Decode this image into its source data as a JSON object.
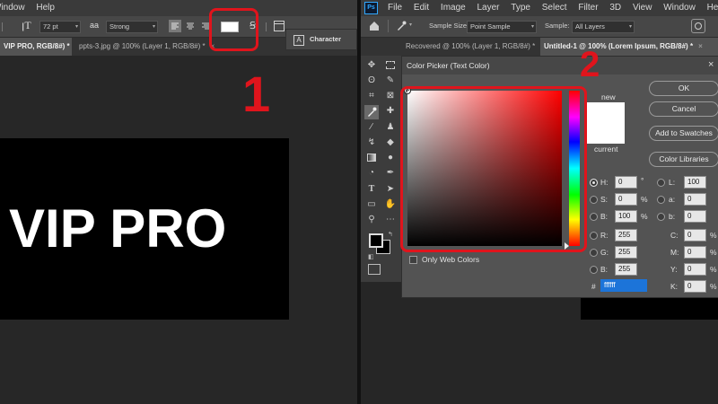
{
  "left": {
    "menu": [
      "Window",
      "Help"
    ],
    "options": {
      "font_size": "72 pt",
      "aa_icon": "aa",
      "antialias": "Strong",
      "character_label": "Character"
    },
    "tabs": [
      {
        "label": "VIP PRO, RGB/8#) *",
        "active": true
      },
      {
        "label": "ppts-3.jpg @ 100% (Layer 1, RGB/8#) *",
        "active": false
      }
    ],
    "canvas_text": "VIP PRO",
    "callout_number": "1"
  },
  "right": {
    "menu": [
      "File",
      "Edit",
      "Image",
      "Layer",
      "Type",
      "Select",
      "Filter",
      "3D",
      "View",
      "Window",
      "Help"
    ],
    "ps_logo": "Ps",
    "options": {
      "sample_size_label": "Sample Size:",
      "sample_size_value": "Point Sample",
      "sample_label": "Sample:",
      "sample_value": "All Layers"
    },
    "tabs": [
      {
        "label": "Recovered @ 100% (Layer 1, RGB/8#) *",
        "active": false
      },
      {
        "label": "Untitled-1 @ 100% (Lorem Ipsum, RGB/8#) *",
        "active": true
      }
    ],
    "callout_number": "2",
    "picker": {
      "title": "Color Picker (Text Color)",
      "new_label": "new",
      "current_label": "current",
      "buttons": [
        "OK",
        "Cancel",
        "Add to Swatches",
        "Color Libraries"
      ],
      "only_web_colors": "Only Web Colors",
      "hsb": [
        {
          "label": "H:",
          "value": "0",
          "unit": "°"
        },
        {
          "label": "S:",
          "value": "0",
          "unit": "%"
        },
        {
          "label": "B:",
          "value": "100",
          "unit": "%"
        }
      ],
      "rgb": [
        {
          "label": "R:",
          "value": "255"
        },
        {
          "label": "G:",
          "value": "255"
        },
        {
          "label": "B:",
          "value": "255"
        }
      ],
      "lab": [
        {
          "label": "L:",
          "value": "100"
        },
        {
          "label": "a:",
          "value": "0"
        },
        {
          "label": "b:",
          "value": "0"
        }
      ],
      "cmyk": [
        {
          "label": "C:",
          "value": "0",
          "unit": "%"
        },
        {
          "label": "M:",
          "value": "0",
          "unit": "%"
        },
        {
          "label": "Y:",
          "value": "0",
          "unit": "%"
        },
        {
          "label": "K:",
          "value": "0",
          "unit": "%"
        }
      ],
      "hex_label": "#",
      "hex_value": "ffffff"
    }
  },
  "colors": {
    "highlight": "#e0141c",
    "hue": "#ff0000",
    "selected": "#ffffff"
  }
}
